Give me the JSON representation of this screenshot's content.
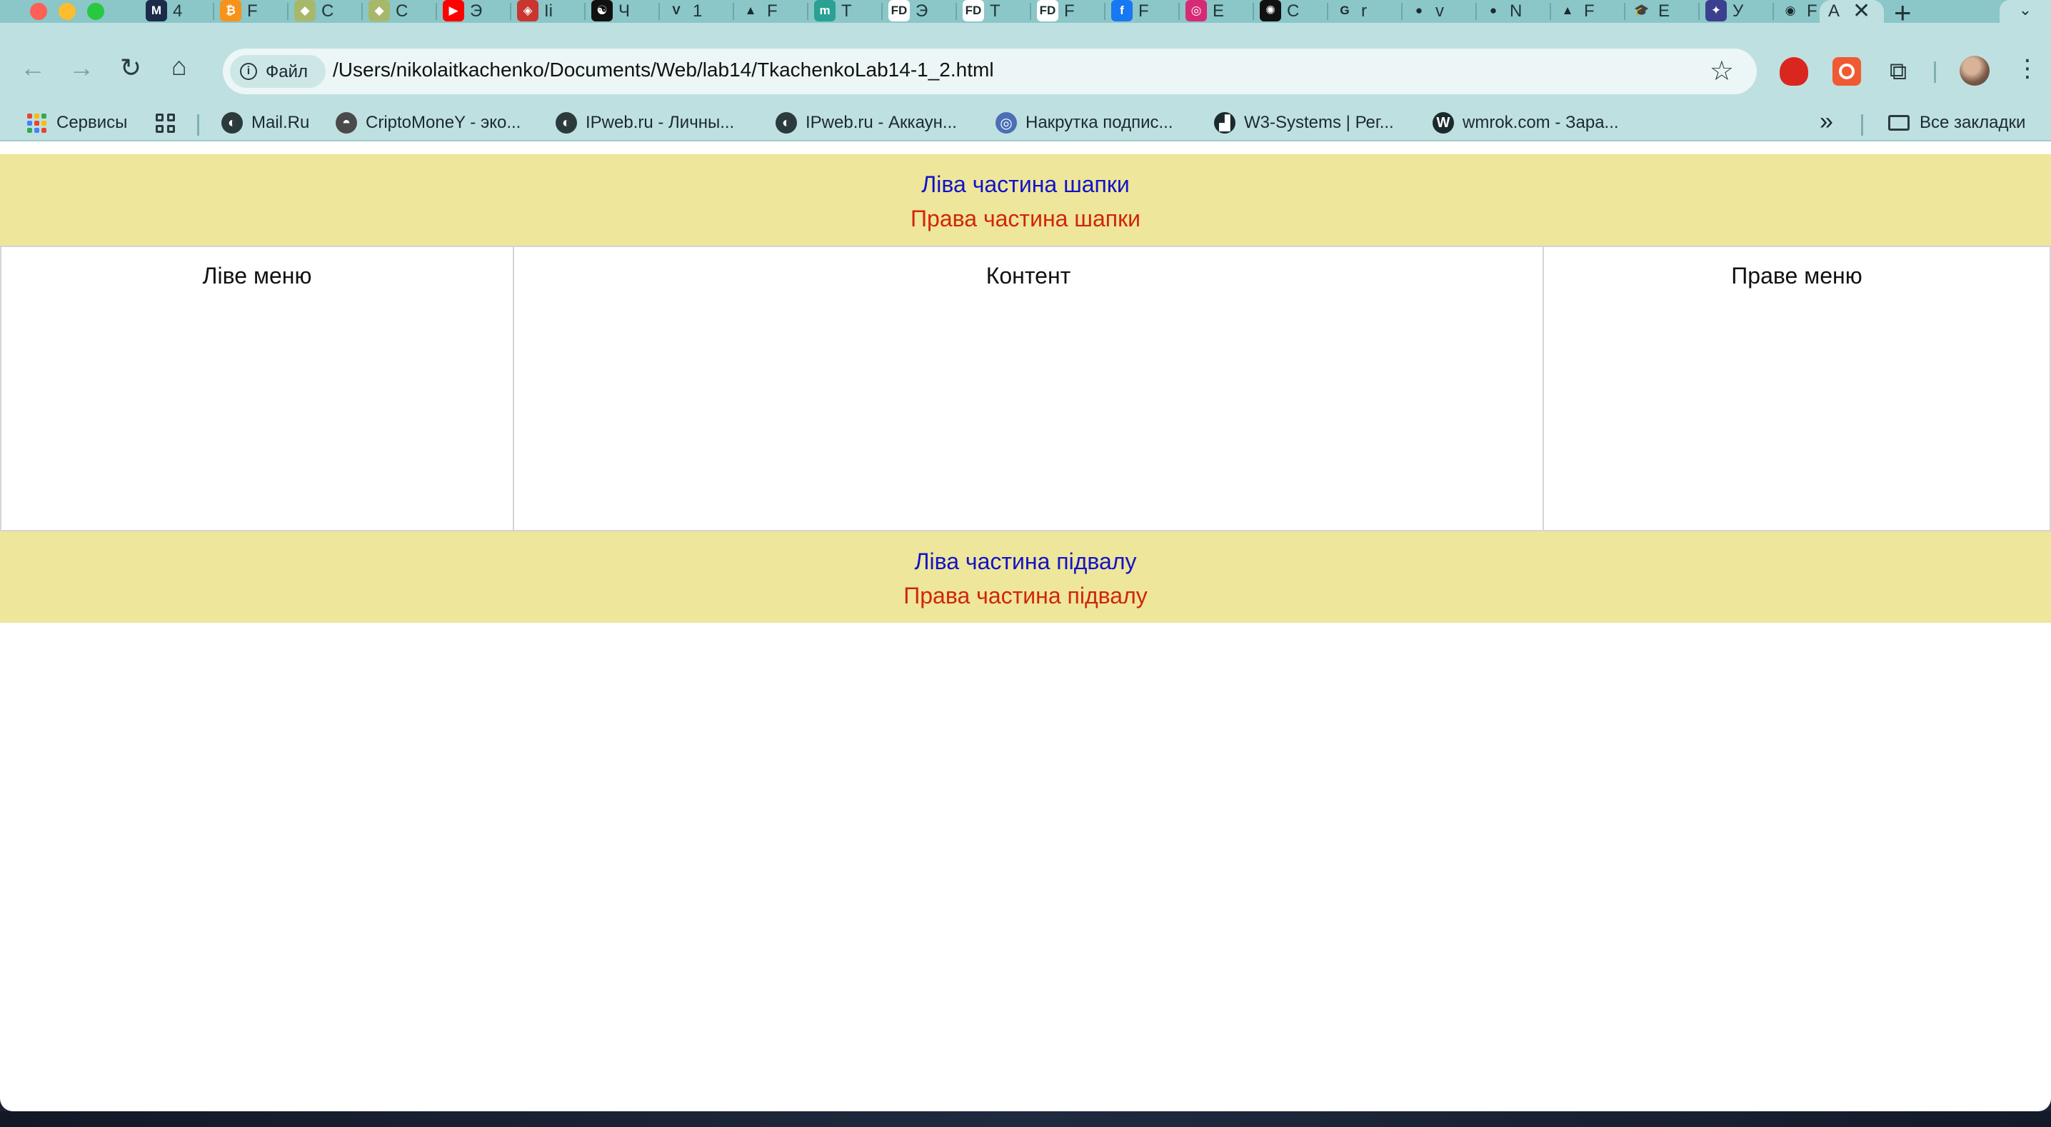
{
  "browser": {
    "tabs": [
      {
        "title": "4",
        "icon": "mastodon-icon",
        "color": "#1c2b4a",
        "glyph": "M"
      },
      {
        "title": "F",
        "icon": "bitcoin-icon",
        "color": "#f7931a",
        "glyph": "₿"
      },
      {
        "title": "C",
        "icon": "emblem-icon",
        "color": "#a8b86a",
        "glyph": "◆"
      },
      {
        "title": "C",
        "icon": "emblem-icon",
        "color": "#a8b86a",
        "glyph": "◆"
      },
      {
        "title": "Э",
        "icon": "youtube-icon",
        "color": "#ff0000",
        "glyph": "▶"
      },
      {
        "title": "Ii",
        "icon": "shield-icon",
        "color": "#c8362f",
        "glyph": "◈"
      },
      {
        "title": "Ч",
        "icon": "yinyang-icon",
        "color": "#111111",
        "glyph": "☯"
      },
      {
        "title": "1",
        "icon": "v-logo-icon",
        "color": "#8bc6c8",
        "glyph": "V"
      },
      {
        "title": "F",
        "icon": "google-drive-icon",
        "color": "#8bc6c8",
        "glyph": "▲"
      },
      {
        "title": "T",
        "icon": "m-logo-icon",
        "color": "#2aa192",
        "glyph": "m"
      },
      {
        "title": "Э",
        "icon": "fd-logo-icon",
        "color": "#ffffff",
        "glyph": "FD"
      },
      {
        "title": "T",
        "icon": "fd-logo-icon",
        "color": "#ffffff",
        "glyph": "FD"
      },
      {
        "title": "F",
        "icon": "fd-logo-icon",
        "color": "#ffffff",
        "glyph": "FD"
      },
      {
        "title": "F",
        "icon": "facebook-icon",
        "color": "#1877f2",
        "glyph": "f"
      },
      {
        "title": "E",
        "icon": "instagram-icon",
        "color": "#d62976",
        "glyph": "◎"
      },
      {
        "title": "C",
        "icon": "chatgpt-icon",
        "color": "#111111",
        "glyph": "✺"
      },
      {
        "title": "r",
        "icon": "google-icon",
        "color": "#8bc6c8",
        "glyph": "G"
      },
      {
        "title": "v",
        "icon": "github-icon",
        "color": "#8bc6c8",
        "glyph": "●"
      },
      {
        "title": "N",
        "icon": "github-icon",
        "color": "#8bc6c8",
        "glyph": "●"
      },
      {
        "title": "F",
        "icon": "google-drive-icon",
        "color": "#8bc6c8",
        "glyph": "▲"
      },
      {
        "title": "E",
        "icon": "mortarboard-icon",
        "color": "#8bc6c8",
        "glyph": "🎓"
      },
      {
        "title": "У",
        "icon": "university-icon",
        "color": "#3b3f8f",
        "glyph": "✦"
      },
      {
        "title": "F",
        "icon": "chrome-icon",
        "color": "#8bc6c8",
        "glyph": "◉"
      }
    ],
    "active_tab": {
      "title": "A",
      "close": "✕"
    },
    "new_tab": "+",
    "tab_search": "⌄",
    "nav": {
      "back": "←",
      "forward": "→",
      "reload": "↻",
      "home": "⌂"
    },
    "address": {
      "chip_label": "Файл",
      "info_glyph": "i",
      "url": "/Users/nikolaitkachenko/Documents/Web/lab14/TkachenkoLab14-1_2.html",
      "star": "☆"
    },
    "extensions": {
      "puzzle": "⧉",
      "menu": "⋮"
    },
    "bookmarks": [
      {
        "label": "Сервисы",
        "icon": "apps-grid-icon"
      },
      {
        "label": "Mail.Ru",
        "icon": "globe-icon",
        "color": "#2b3b3d",
        "glyph": "◐"
      },
      {
        "label": "CriptoMoneY - эко...",
        "icon": "coin-icon",
        "color": "#4a4a4a",
        "glyph": "◓"
      },
      {
        "label": "IPweb.ru - Личны...",
        "icon": "globe-icon",
        "color": "#2b3b3d",
        "glyph": "◐"
      },
      {
        "label": "IPweb.ru - Аккаун...",
        "icon": "globe-icon",
        "color": "#2b3b3d",
        "glyph": "◐"
      },
      {
        "label": "Накрутка подпис...",
        "icon": "spiral-icon",
        "color": "#4a6fb5",
        "glyph": "◎"
      },
      {
        "label": "W3-Systems | Рег...",
        "icon": "chart-icon",
        "color": "#1b2a2c",
        "glyph": "▟"
      },
      {
        "label": "wmrok.com - Зара...",
        "icon": "w-logo-icon",
        "color": "#1b2a2c",
        "glyph": "W"
      }
    ],
    "bookmarks_overflow": "»",
    "all_bookmarks": "Все закладки"
  },
  "page": {
    "header": {
      "left": "Ліва частина шапки",
      "right": "Права частина шапки"
    },
    "left_menu": "Ліве меню",
    "content": "Контент",
    "right_menu": "Праве меню",
    "footer": {
      "left": "Ліва частина підвалу",
      "right": "Права частина підвалу"
    }
  },
  "colors": {
    "header_bg": "#eee69a",
    "left_text": "#1212c8",
    "right_text": "#d0260a",
    "browser_frame": "#bfe0e0",
    "tabstrip": "#8bc6c8"
  }
}
